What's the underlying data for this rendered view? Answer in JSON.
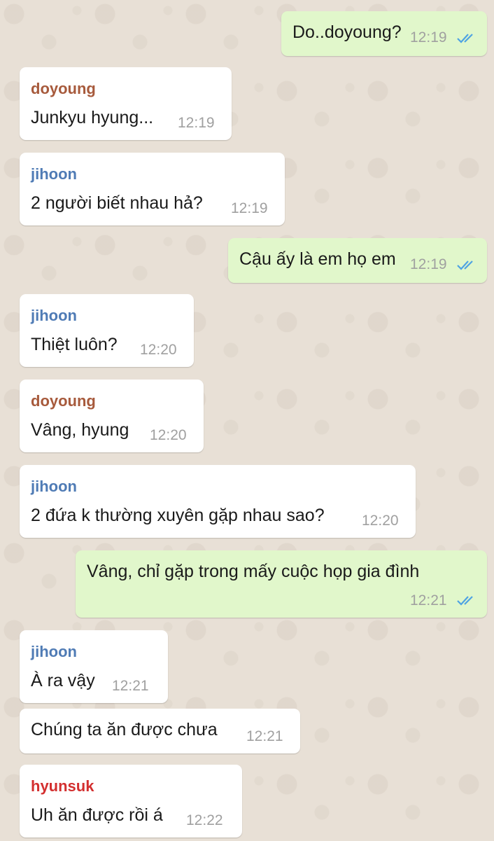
{
  "colors": {
    "wallpaper": "#e8e0d6",
    "incoming_bubble": "#ffffff",
    "outgoing_bubble": "#e1f7cb",
    "read_ticks": "#4fa3e3",
    "sender_doyoung": "#a75a3c",
    "sender_jihoon": "#4f7bb5",
    "sender_hyunsuk": "#d32f2f"
  },
  "messages": [
    {
      "direction": "out",
      "text": "Do..doyoung?",
      "time": "12:19",
      "status": "read-double-tick-icon"
    },
    {
      "direction": "in",
      "sender": "doyoung",
      "text": "Junkyu hyung...",
      "time": "12:19"
    },
    {
      "direction": "in",
      "sender": "jihoon",
      "text": "2 người biết nhau hả?",
      "time": "12:19"
    },
    {
      "direction": "out",
      "text": "Cậu ấy là em họ em",
      "time": "12:19",
      "status": "read-double-tick-icon"
    },
    {
      "direction": "in",
      "sender": "jihoon",
      "text": "Thiệt luôn?",
      "time": "12:20"
    },
    {
      "direction": "in",
      "sender": "doyoung",
      "text": "Vâng, hyung",
      "time": "12:20"
    },
    {
      "direction": "in",
      "sender": "jihoon",
      "text": "2 đứa k thường xuyên gặp nhau sao?",
      "time": "12:20"
    },
    {
      "direction": "out",
      "text": "Vâng, chỉ gặp trong mấy cuộc họp gia đình",
      "time": "12:21",
      "status": "read-double-tick-icon"
    },
    {
      "direction": "in",
      "sender": "jihoon",
      "text": "À ra vậy",
      "time": "12:21"
    },
    {
      "direction": "in",
      "text": "Chúng ta ăn được chưa",
      "time": "12:21"
    },
    {
      "direction": "in",
      "sender": "hyunsuk",
      "text": "Uh ăn được rồi á",
      "time": "12:22"
    }
  ]
}
